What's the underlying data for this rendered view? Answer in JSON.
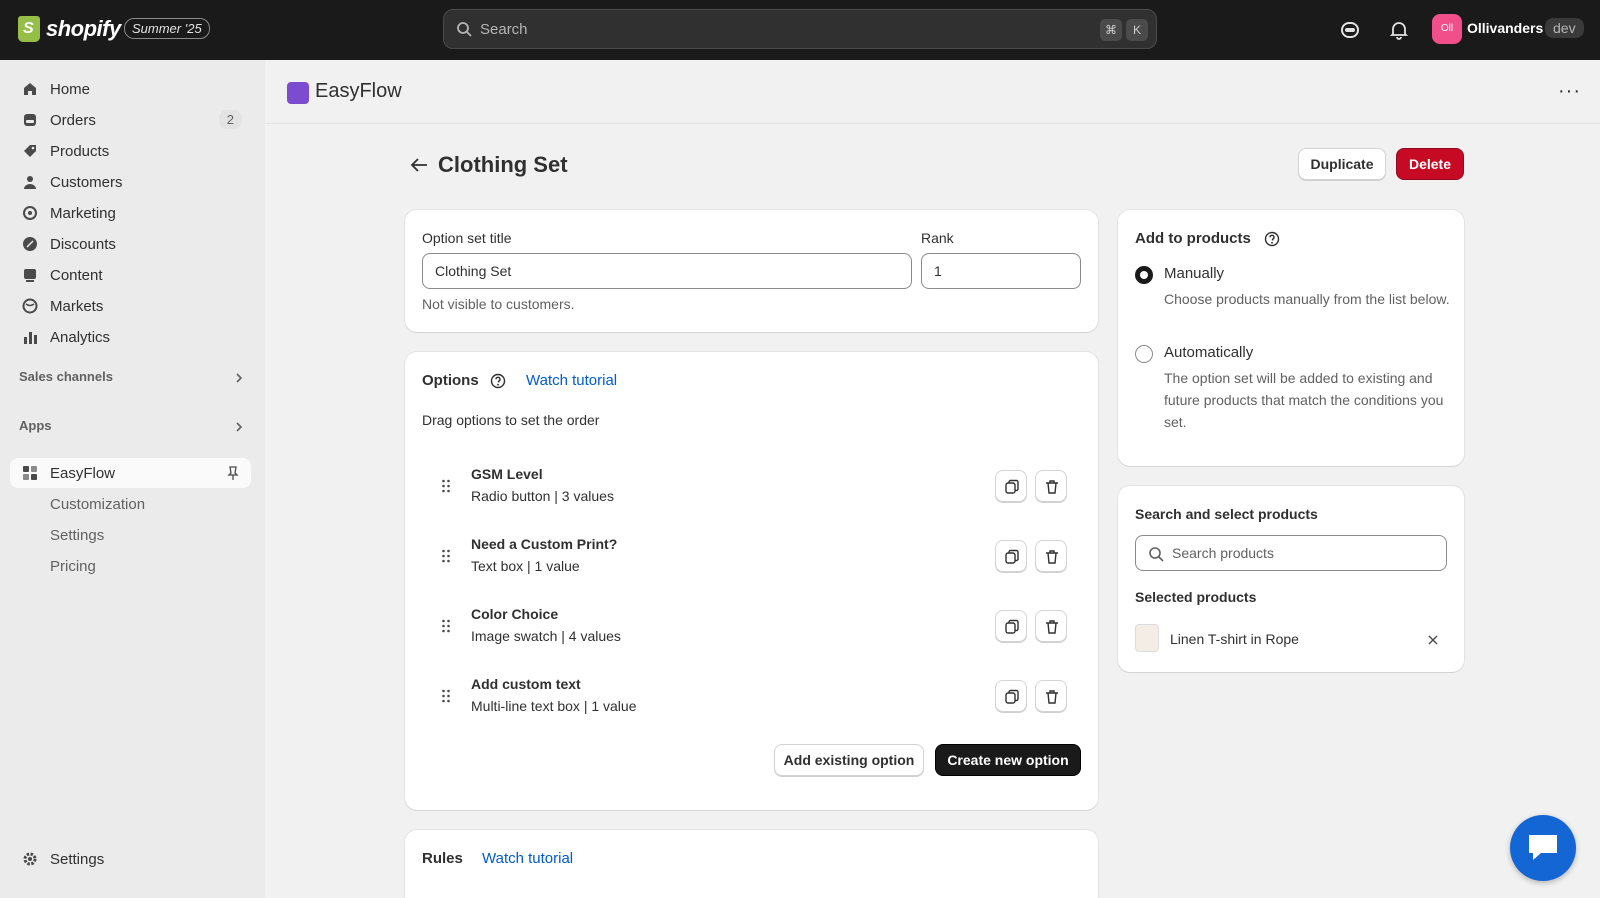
{
  "topbar": {
    "brand": "shopify",
    "edition": "Summer '25",
    "search_placeholder": "Search",
    "shortcut_keys": [
      "⌘",
      "K"
    ],
    "store_initials": "Oll",
    "store_name": "Ollivanders",
    "env_badge": "dev"
  },
  "sidebar": {
    "items": [
      {
        "label": "Home",
        "icon": "home-icon"
      },
      {
        "label": "Orders",
        "icon": "orders-icon",
        "badge": "2"
      },
      {
        "label": "Products",
        "icon": "tag-icon"
      },
      {
        "label": "Customers",
        "icon": "person-icon"
      },
      {
        "label": "Marketing",
        "icon": "target-icon"
      },
      {
        "label": "Discounts",
        "icon": "discount-icon"
      },
      {
        "label": "Content",
        "icon": "content-icon"
      },
      {
        "label": "Markets",
        "icon": "globe-icon"
      },
      {
        "label": "Analytics",
        "icon": "bar-chart-icon"
      }
    ],
    "sales_channels_label": "Sales channels",
    "apps_label": "Apps",
    "app_item": {
      "label": "EasyFlow"
    },
    "app_sub_items": [
      "Customization",
      "Settings",
      "Pricing"
    ],
    "settings_label": "Settings"
  },
  "app_header": {
    "title": "EasyFlow",
    "more": "···"
  },
  "page": {
    "title": "Clothing Set",
    "duplicate_label": "Duplicate",
    "delete_label": "Delete"
  },
  "option_set": {
    "title_label": "Option set title",
    "title_value": "Clothing Set",
    "rank_label": "Rank",
    "rank_value": "1",
    "help_text": "Not visible to customers."
  },
  "options_card": {
    "title": "Options",
    "tutorial_link": "Watch tutorial",
    "instructions": "Drag options to set the order",
    "items": [
      {
        "name": "GSM Level",
        "meta": "Radio button | 3 values"
      },
      {
        "name": "Need a Custom Print?",
        "meta": "Text box | 1 value"
      },
      {
        "name": "Color Choice",
        "meta": "Image swatch | 4 values"
      },
      {
        "name": "Add custom text",
        "meta": "Multi-line text box | 1 value"
      }
    ],
    "add_existing_label": "Add existing option",
    "create_new_label": "Create new option"
  },
  "rules_card": {
    "title": "Rules",
    "tutorial_link": "Watch tutorial"
  },
  "add_to_products": {
    "title": "Add to products",
    "manual_label": "Manually",
    "manual_help": "Choose products manually from the list below.",
    "auto_label": "Automatically",
    "auto_help": "The option set will be added to existing and future products that match the conditions you set.",
    "selected_mode": "Manually"
  },
  "product_search": {
    "title": "Search and select products",
    "placeholder": "Search products",
    "selected_title": "Selected products",
    "selected": [
      {
        "name": "Linen T-shirt in Rope"
      }
    ]
  },
  "colors": {
    "topbar": "#1a1a1a",
    "danger": "#c70a24",
    "primary": "#1a1a1a",
    "link": "#005bd3",
    "chat": "#1466d4"
  }
}
